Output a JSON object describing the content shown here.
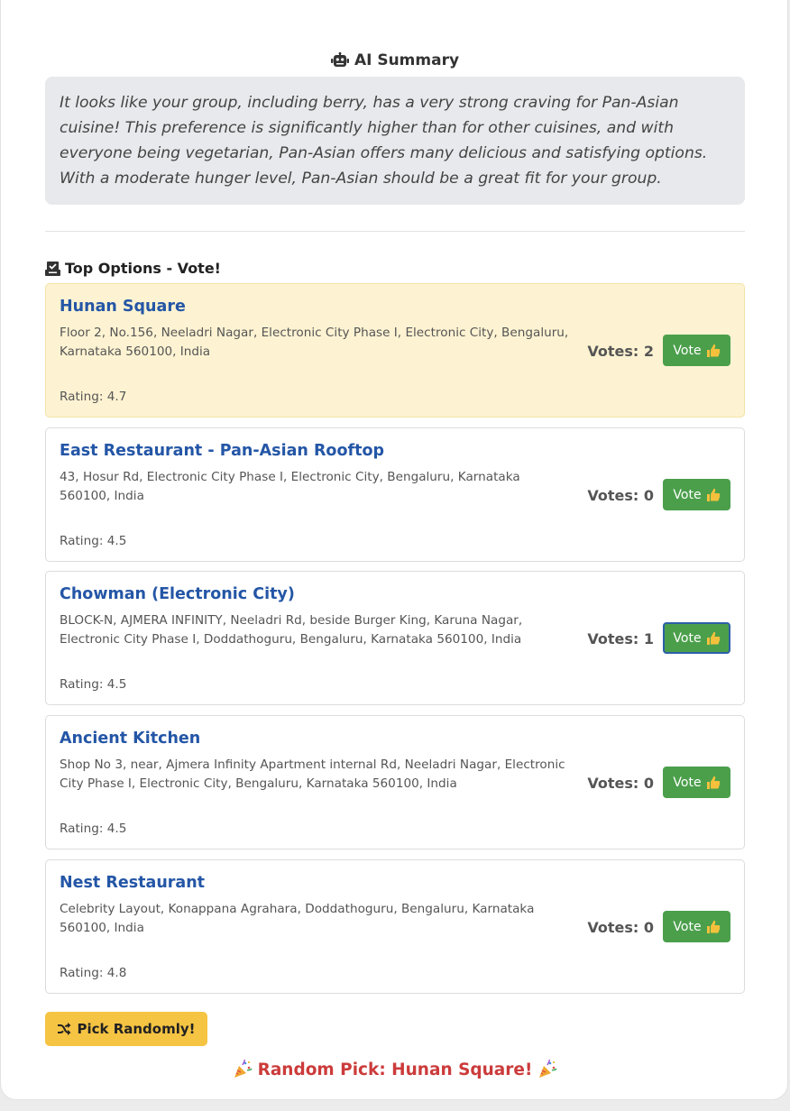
{
  "summary": {
    "title": "AI Summary",
    "icon": "robot-icon",
    "text": "It looks like your group, including berry, has a very strong craving for Pan-Asian cuisine! This preference is significantly higher than for other cuisines, and with everyone being vegetarian, Pan-Asian offers many delicious and satisfying options. With a moderate hunger level, Pan-Asian should be a great fit for your group."
  },
  "options_section": {
    "title": "Top Options - Vote!",
    "icon": "ballot-box-icon",
    "vote_button_label": "Vote",
    "vote_icon": "thumbs-up-icon",
    "highlight_color": "#fdf3d2",
    "name_color": "#2456a6",
    "button_color": "#4b9f4b",
    "items": [
      {
        "name": "Hunan Square",
        "address": "Floor 2, No.156, Neeladri Nagar, Electronic City Phase I, Electronic City, Bengaluru, Karnataka 560100, India",
        "rating": "Rating: 4.7",
        "votes": "Votes: 2",
        "highlighted": true
      },
      {
        "name": "East Restaurant - Pan-Asian Rooftop",
        "address": "43, Hosur Rd, Electronic City Phase I, Electronic City, Bengaluru, Karnataka 560100, India",
        "rating": "Rating: 4.5",
        "votes": "Votes: 0",
        "highlighted": false
      },
      {
        "name": "Chowman (Electronic City)",
        "address": "BLOCK-N, AJMERA INFINITY, Neeladri Rd, beside Burger King, Karuna Nagar, Electronic City Phase I, Doddathoguru, Bengaluru, Karnataka 560100, India",
        "rating": "Rating: 4.5",
        "votes": "Votes: 1",
        "highlighted": false
      },
      {
        "name": "Ancient Kitchen",
        "address": "Shop No 3, near, Ajmera Infinity Apartment internal Rd, Neeladri Nagar, Electronic City Phase I, Electronic City, Bengaluru, Karnataka 560100, India",
        "rating": "Rating: 4.5",
        "votes": "Votes: 0",
        "highlighted": false
      },
      {
        "name": "Nest Restaurant",
        "address": "Celebrity Layout, Konappana Agrahara, Doddathoguru, Bengaluru, Karnataka 560100, India",
        "rating": "Rating: 4.8",
        "votes": "Votes: 0",
        "highlighted": false
      }
    ]
  },
  "pick_button": {
    "label": "Pick Randomly!",
    "icon": "shuffle-icon",
    "color": "#f6c443"
  },
  "random_pick": {
    "text": "Random Pick: Hunan Square!",
    "icon": "party-popper-icon",
    "color": "#cc3b3b"
  }
}
